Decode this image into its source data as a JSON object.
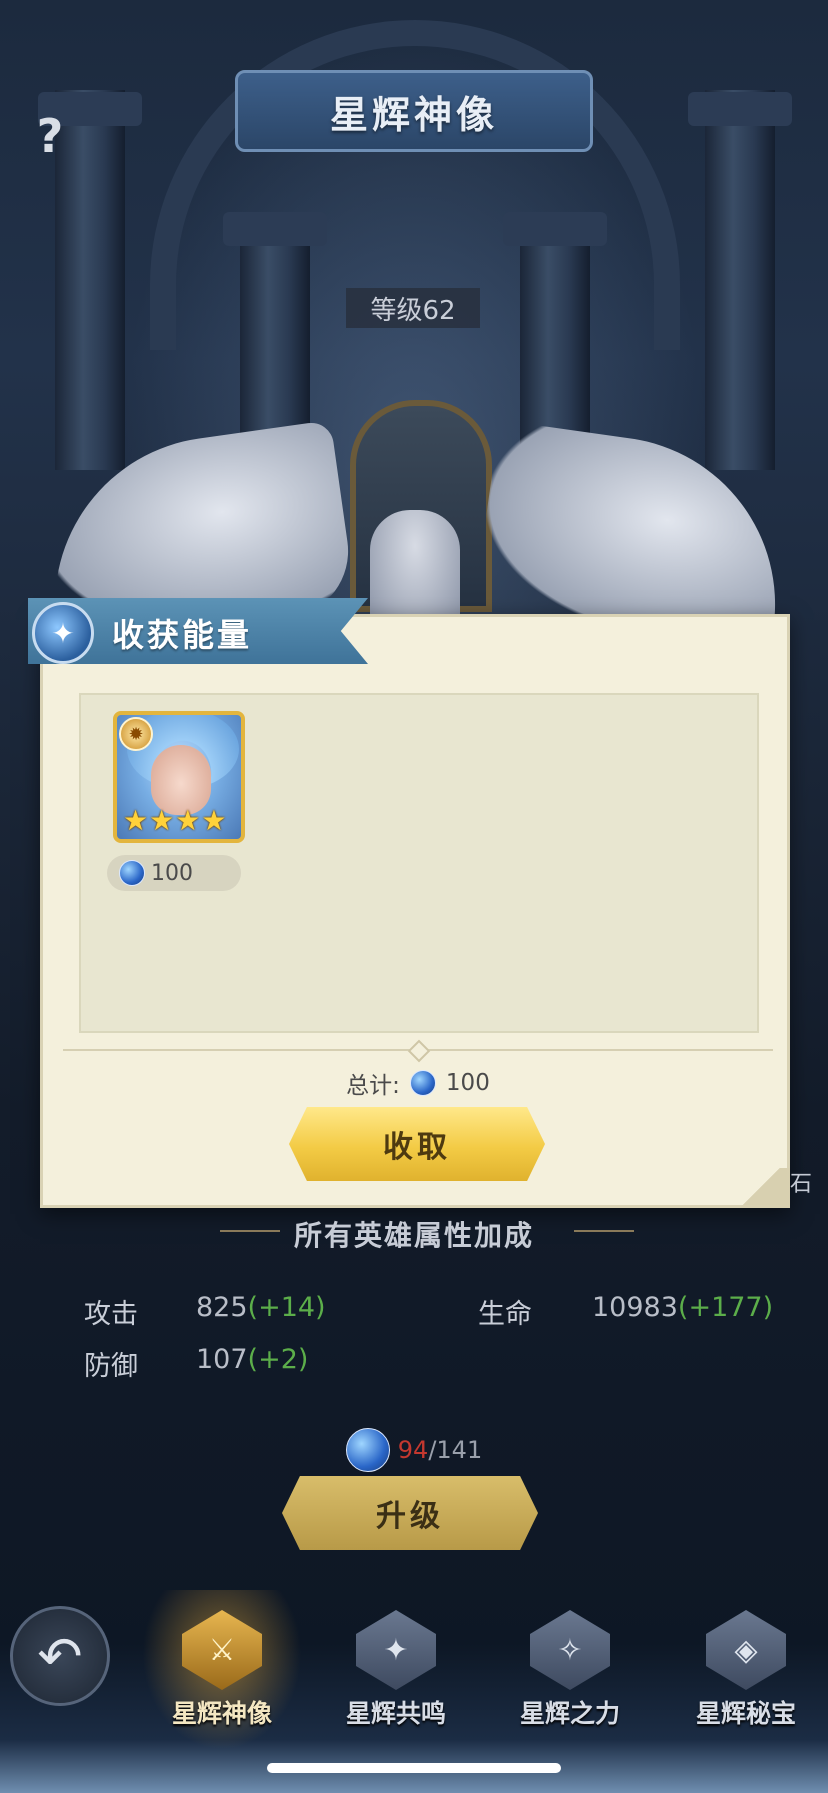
{
  "header": {
    "title": "星辉神像",
    "help_icon": "question-mark",
    "level_label": "等级62"
  },
  "dialog": {
    "title": "收获能量",
    "title_icon": "crystal-shard-icon",
    "hero": {
      "stars": 4,
      "star_glyph": "★",
      "badge_icon": "sun-badge",
      "energy_value": "100"
    },
    "total_label": "总计:",
    "total_value": "100",
    "collect_label": "收取"
  },
  "side_text": "石",
  "bonus": {
    "title": "所有英雄属性加成",
    "stats": [
      {
        "label": "攻击",
        "value": "825",
        "delta": "(+14)"
      },
      {
        "label": "生命",
        "value": "10983",
        "delta": "(+177)"
      },
      {
        "label": "防御",
        "value": "107",
        "delta": "(+2)"
      }
    ]
  },
  "upgrade": {
    "cost_have": "94",
    "cost_need": "/141",
    "button_label": "升级"
  },
  "nav": {
    "back_icon": "back-arrow",
    "tabs": [
      {
        "label": "星辉神像",
        "active": true
      },
      {
        "label": "星辉共鸣",
        "active": false
      },
      {
        "label": "星辉之力",
        "active": false
      },
      {
        "label": "星辉秘宝",
        "active": false
      }
    ]
  },
  "colors": {
    "accent_gold": "#f3cb45",
    "stat_plus_green": "#5cae4a",
    "cost_short_red": "#c4382f",
    "ribbon_blue": "#4f86ab"
  }
}
